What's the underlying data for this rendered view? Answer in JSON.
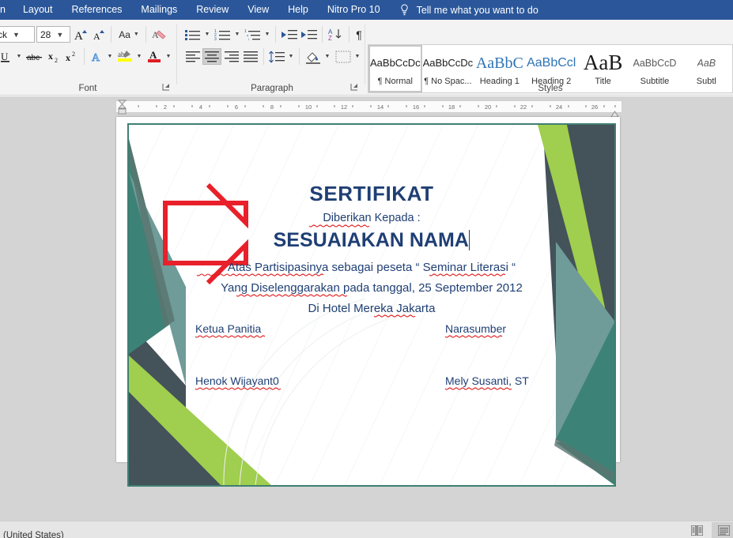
{
  "window": {
    "app": "Microsoft Word",
    "accent_color": "#2b579a"
  },
  "ribbon_tabs": [
    {
      "label": "n",
      "clipped": true
    },
    {
      "label": "Layout"
    },
    {
      "label": "References"
    },
    {
      "label": "Mailings"
    },
    {
      "label": "Review"
    },
    {
      "label": "View"
    },
    {
      "label": "Help"
    },
    {
      "label": "Nitro Pro 10"
    }
  ],
  "tellme": {
    "icon": "lightbulb-icon",
    "label": "Tell me what you want to do"
  },
  "font_group": {
    "label": "Font",
    "font_name_value": "ck",
    "font_size_value": "28",
    "buttons": [
      {
        "name": "grow-font",
        "label": "A"
      },
      {
        "name": "shrink-font",
        "label": "A"
      },
      {
        "name": "change-case",
        "label": "Aa"
      },
      {
        "name": "clear-formatting",
        "label": "A"
      },
      {
        "name": "underline",
        "label": "U"
      },
      {
        "name": "strikethrough",
        "label": "abc"
      },
      {
        "name": "subscript",
        "label": "x₂"
      },
      {
        "name": "superscript",
        "label": "x²"
      },
      {
        "name": "text-effects",
        "label": "A"
      },
      {
        "name": "text-highlight-color",
        "label": "ab"
      },
      {
        "name": "font-color",
        "label": "A"
      }
    ],
    "highlight_color": "#ffff00",
    "font_color": "#e01b24",
    "dialog_launcher": "⬌"
  },
  "paragraph_group": {
    "label": "Paragraph",
    "buttons": [
      {
        "name": "bullets"
      },
      {
        "name": "numbering"
      },
      {
        "name": "multilevel-list"
      },
      {
        "name": "decrease-indent"
      },
      {
        "name": "increase-indent"
      },
      {
        "name": "sort"
      },
      {
        "name": "show-formatting-marks",
        "label": "¶"
      },
      {
        "name": "align-left"
      },
      {
        "name": "align-center",
        "selected": true
      },
      {
        "name": "align-right"
      },
      {
        "name": "justify"
      },
      {
        "name": "line-spacing"
      },
      {
        "name": "shading"
      },
      {
        "name": "borders"
      }
    ],
    "dialog_launcher": "⬌"
  },
  "styles_group": {
    "label": "Styles",
    "items": [
      {
        "preview": "AaBbCcDc",
        "name": "¶ Normal",
        "active": true,
        "color": "#202020",
        "size": "13px",
        "serif": false
      },
      {
        "preview": "AaBbCcDc",
        "name": "¶ No Spac...",
        "active": false,
        "color": "#202020",
        "size": "13px",
        "serif": false
      },
      {
        "preview": "AaBbC",
        "name": "Heading 1",
        "active": false,
        "color": "#2e74b5",
        "size": "20px",
        "serif": true
      },
      {
        "preview": "AaBbCcl",
        "name": "Heading 2",
        "active": false,
        "color": "#2e74b5",
        "size": "16px",
        "serif": false
      },
      {
        "preview": "AaB",
        "name": "Title",
        "active": false,
        "color": "#1a1a1a",
        "size": "28px",
        "serif": true
      },
      {
        "preview": "AaBbCcD",
        "name": "Subtitle",
        "active": false,
        "color": "#5a5a5a",
        "size": "13px",
        "serif": false
      },
      {
        "preview": "AaB",
        "name": "Subtl",
        "active": false,
        "color": "#5a5a5a",
        "size": "13px",
        "serif": false
      }
    ]
  },
  "ruler": {
    "numbers": [
      2,
      4,
      6,
      8,
      10,
      12,
      14,
      16,
      18,
      20,
      22,
      24,
      26
    ]
  },
  "certificate": {
    "title": "SERTIFIKAT",
    "subtitle": "Diberikan Kepada :",
    "recipient_name": "SESUAIAKAN NAMA",
    "line1": "Atas Partisipasinya sebagai peseta “ Seminar Literasi “",
    "line2": "Yang Diselenggarakan pada tanggal, 25 September 2012",
    "line3": "Di Hotel Mereka Jakarta",
    "signature_left_role": "Ketua Panitia",
    "signature_right_role": "Narasumber",
    "signature_left_name": "Henok Wijayant0",
    "signature_right_name": "Mely Susanti, ST",
    "text_color": "#1f3f74",
    "border_color": "#3f7f72",
    "colors": {
      "dark_slate": "#44525a",
      "teal_dark": "#3d8276",
      "teal_light": "#6f9b98",
      "lime": "#a0ce4e",
      "shadow": "#5a7570"
    },
    "annotation_arrow": {
      "name": "red-arrow-annotation",
      "color": "#e8202a"
    }
  },
  "statusbar": {
    "language": "(United States)",
    "view_buttons": [
      {
        "name": "print-layout-view"
      },
      {
        "name": "web-layout-view",
        "active": true
      }
    ]
  }
}
